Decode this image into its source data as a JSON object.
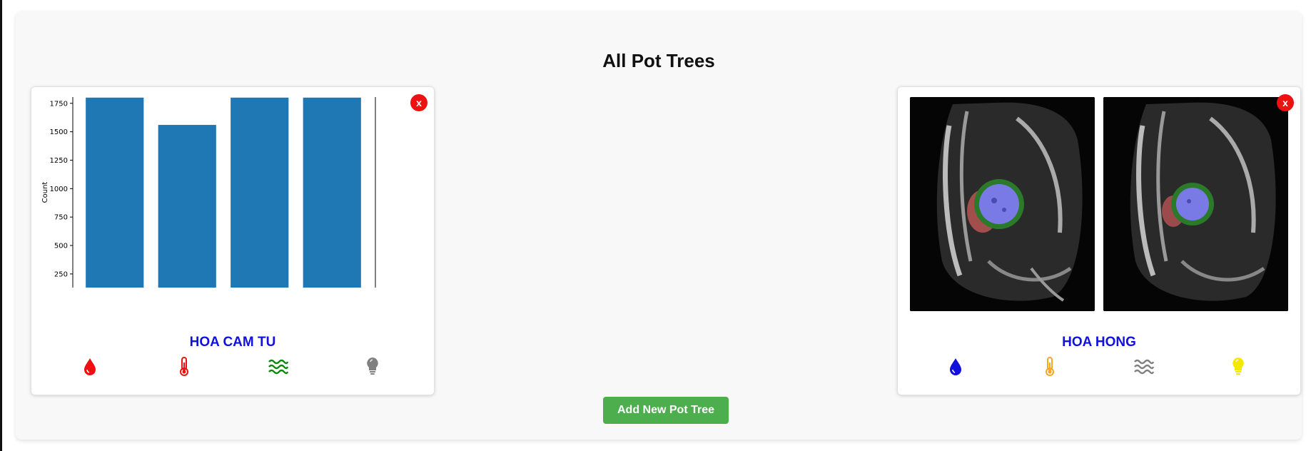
{
  "page": {
    "title": "All Pot Trees"
  },
  "trees": [
    {
      "name": "HOA CAM TU",
      "close_label": "x",
      "icons": [
        {
          "name": "water-drop-icon",
          "color": "#ee1111"
        },
        {
          "name": "thermometer-icon",
          "color": "#ee1111"
        },
        {
          "name": "humidity-waves-icon",
          "color": "#0a8a0a"
        },
        {
          "name": "light-bulb-icon",
          "color": "#808080"
        }
      ]
    },
    {
      "name": "HOA HONG",
      "close_label": "x",
      "icons": [
        {
          "name": "water-drop-icon",
          "color": "#1111dd"
        },
        {
          "name": "thermometer-icon",
          "color": "#f5a623"
        },
        {
          "name": "humidity-waves-icon",
          "color": "#808080"
        },
        {
          "name": "light-bulb-icon",
          "color": "#f5e800"
        }
      ]
    }
  ],
  "chart_data": {
    "type": "bar",
    "categories": [
      "",
      "",
      "",
      ""
    ],
    "values": [
      1800,
      1560,
      1800,
      1800
    ],
    "ylabel": "Count",
    "yticks": [
      250,
      500,
      750,
      1000,
      1250,
      1500,
      1750
    ],
    "ylim": [
      130,
      1805
    ],
    "bar_color": "#1f77b4"
  },
  "add_button": {
    "label": "Add New Pot Tree"
  }
}
